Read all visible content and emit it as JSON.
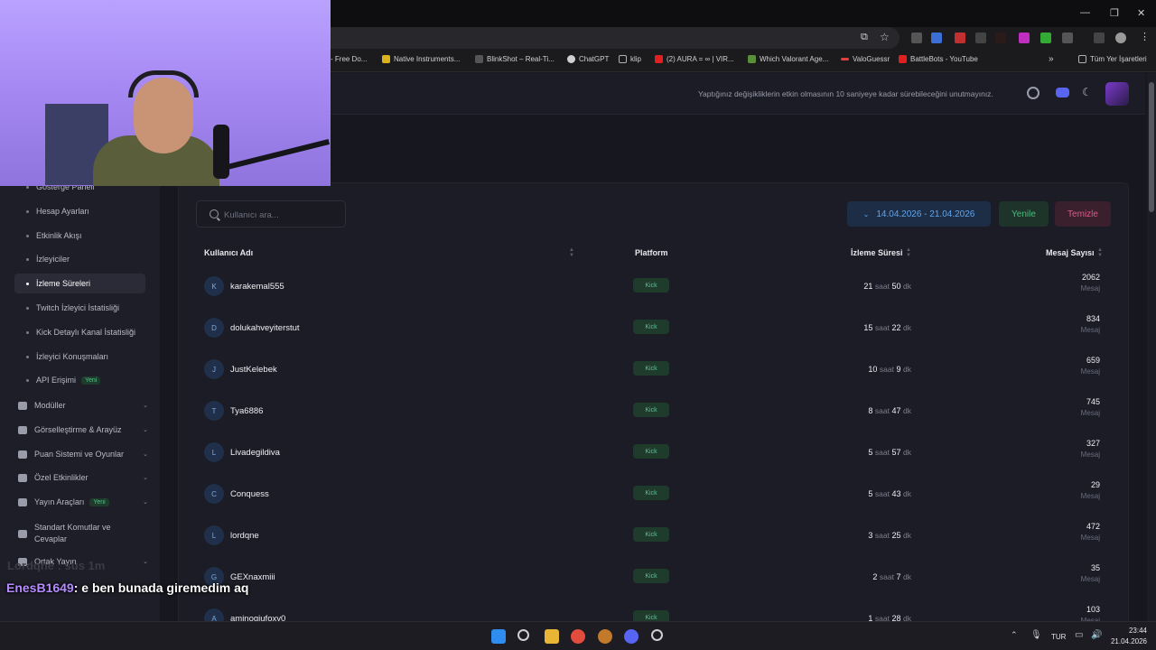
{
  "browser": {
    "bookmarks": [
      {
        "label": "- Free Do...",
        "color": "#3a3a3a"
      },
      {
        "label": "Native Instruments...",
        "color": "#d9b21c"
      },
      {
        "label": "BlinkShot – Real-Ti...",
        "color": "#555555"
      },
      {
        "label": "ChatGPT",
        "color": "#d0d0d0"
      },
      {
        "label": "klip",
        "color": "#b0b0b0"
      },
      {
        "label": "(2) AURA = ∞ | VIR...",
        "color": "#e02020"
      },
      {
        "label": "Which Valorant Age...",
        "color": "#5a8f3a"
      },
      {
        "label": "ValoGuessr",
        "color": "#e04040"
      },
      {
        "label": "BattleBots - YouTube",
        "color": "#e02020"
      }
    ],
    "all_bookmarks_label": "Tüm Yer İşaretleri",
    "more_label": "»"
  },
  "header": {
    "notice": "Yaptığınız değişikliklerin etkin olmasının 10 saniyeye kadar sürebileceğini unutmayınız."
  },
  "sidebar": {
    "sub_items": [
      {
        "label": "Gösterge Paneli",
        "active": false
      },
      {
        "label": "Hesap Ayarları",
        "active": false
      },
      {
        "label": "Etkinlik Akışı",
        "active": false
      },
      {
        "label": "İzleyiciler",
        "active": false
      },
      {
        "label": "İzleme Süreleri",
        "active": true
      },
      {
        "label": "Twitch İzleyici İstatisliği",
        "active": false
      },
      {
        "label": "Kick Detaylı Kanal İstatisliği",
        "active": false
      },
      {
        "label": "İzleyici Konuşmaları",
        "active": false
      },
      {
        "label": "API Erişimi",
        "active": false,
        "badge": "Yeni"
      }
    ],
    "groups": [
      {
        "label": "Modüller",
        "icon": "grid-icon"
      },
      {
        "label": "Görselleştirme & Arayüz",
        "icon": "palette-icon"
      },
      {
        "label": "Puan Sistemi ve Oyunlar",
        "icon": "coin-icon"
      },
      {
        "label": "Özel Etkinlikler",
        "icon": "calendar-icon"
      },
      {
        "label": "Yayın Araçları",
        "icon": "tools-icon",
        "badge": "Yeni"
      },
      {
        "label": "Standart Komutlar ve Cevaplar",
        "icon": "keyboard-icon"
      },
      {
        "label": "Ortak Yayın",
        "icon": "users-icon"
      }
    ]
  },
  "toolbar": {
    "search_placeholder": "Kullanıcı ara...",
    "date_range": "14.04.2026 - 21.04.2026",
    "refresh_label": "Yenile",
    "clear_label": "Temizle"
  },
  "table": {
    "columns": [
      "Kullanıcı Adı",
      "Platform",
      "İzleme Süresi",
      "Mesaj Sayısı"
    ],
    "hour_unit": "saat",
    "minute_unit": "dk",
    "message_unit": "Mesaj",
    "rows": [
      {
        "initial": "K",
        "username": "karakemal555",
        "platform": "Kick",
        "hours": "21",
        "minutes": "50",
        "messages": "2062"
      },
      {
        "initial": "D",
        "username": "dolukahveyiterstut",
        "platform": "Kick",
        "hours": "15",
        "minutes": "22",
        "messages": "834"
      },
      {
        "initial": "J",
        "username": "JustKelebek",
        "platform": "Kick",
        "hours": "10",
        "minutes": "9",
        "messages": "659"
      },
      {
        "initial": "T",
        "username": "Tya6886",
        "platform": "Kick",
        "hours": "8",
        "minutes": "47",
        "messages": "745"
      },
      {
        "initial": "L",
        "username": "Livadegildiva",
        "platform": "Kick",
        "hours": "5",
        "minutes": "57",
        "messages": "327"
      },
      {
        "initial": "C",
        "username": "Conquess",
        "platform": "Kick",
        "hours": "5",
        "minutes": "43",
        "messages": "29"
      },
      {
        "initial": "L",
        "username": "lordqne",
        "platform": "Kick",
        "hours": "3",
        "minutes": "25",
        "messages": "472"
      },
      {
        "initial": "G",
        "username": "GEXnaxmiii",
        "platform": "Kick",
        "hours": "2",
        "minutes": "7",
        "messages": "35"
      },
      {
        "initial": "A",
        "username": "aminogiufoxy0",
        "platform": "Kick",
        "hours": "1",
        "minutes": "28",
        "messages": "103"
      }
    ]
  },
  "overlay": {
    "ghost_text": "Lordqne : sus 1m",
    "chat_user": "EnesB1649",
    "chat_message": ": e ben bunada giremedim aq"
  },
  "taskbar": {
    "language": "TUR",
    "time": "23:44",
    "date": "21.04.2026"
  },
  "colors": {
    "accent_blue": "#5fa6f0",
    "accent_green": "#4fb97f",
    "accent_pink": "#e05a87",
    "background": "#16171f"
  }
}
